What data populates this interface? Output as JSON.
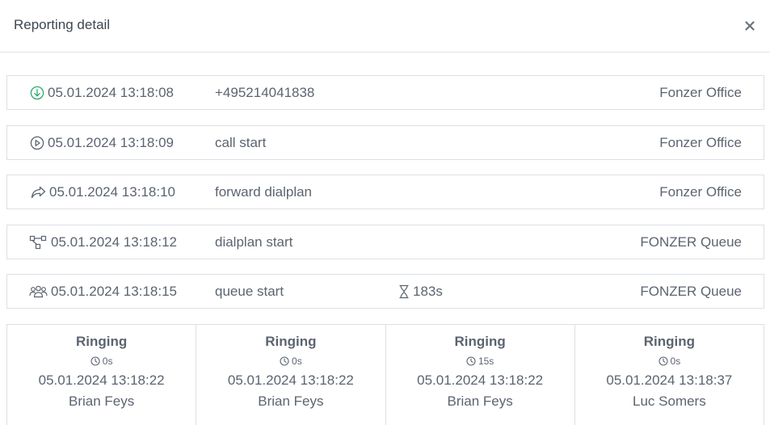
{
  "header": {
    "title": "Reporting detail",
    "close_icon": "close-icon"
  },
  "events": [
    {
      "icon": "incoming-call-icon",
      "timestamp": "05.01.2024 13:18:08",
      "event": "+495214041838",
      "duration": "",
      "target": "Fonzer Office"
    },
    {
      "icon": "play-icon",
      "timestamp": "05.01.2024 13:18:09",
      "event": "call start",
      "duration": "",
      "target": "Fonzer Office"
    },
    {
      "icon": "forward-icon",
      "timestamp": "05.01.2024 13:18:10",
      "event": "forward dialplan",
      "duration": "",
      "target": "Fonzer Office"
    },
    {
      "icon": "dialplan-icon",
      "timestamp": "05.01.2024 13:18:12",
      "event": "dialplan start",
      "duration": "",
      "target": "FONZER Queue"
    },
    {
      "icon": "queue-icon",
      "timestamp": "05.01.2024 13:18:15",
      "event": "queue start",
      "duration": "183s",
      "target": "FONZER Queue"
    }
  ],
  "ringing": [
    {
      "status": "Ringing",
      "duration": "0s",
      "timestamp": "05.01.2024 13:18:22",
      "agent": "Brian Feys"
    },
    {
      "status": "Ringing",
      "duration": "0s",
      "timestamp": "05.01.2024 13:18:22",
      "agent": "Brian Feys"
    },
    {
      "status": "Ringing",
      "duration": "15s",
      "timestamp": "05.01.2024 13:18:22",
      "agent": "Brian Feys"
    },
    {
      "status": "Ringing",
      "duration": "0s",
      "timestamp": "05.01.2024 13:18:37",
      "agent": "Luc Somers"
    }
  ],
  "colors": {
    "accent_green": "#2bab6a",
    "text": "#5c6470",
    "border": "#dcdfe3"
  }
}
